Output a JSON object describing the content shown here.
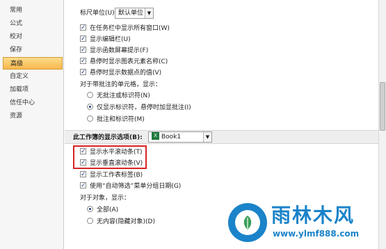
{
  "sidebar": {
    "items": [
      {
        "label": "常用"
      },
      {
        "label": "公式"
      },
      {
        "label": "校对"
      },
      {
        "label": "保存"
      },
      {
        "label": "高级"
      },
      {
        "label": "自定义"
      },
      {
        "label": "加载项"
      },
      {
        "label": "信任中心"
      },
      {
        "label": "资源"
      }
    ],
    "active_index": 4
  },
  "ruler_units": {
    "label": "标尺单位(U)",
    "value": "默认单位"
  },
  "display_options": [
    {
      "label": "在任务栏中显示所有窗口(W)",
      "checked": true
    },
    {
      "label": "显示编辑栏(U)",
      "checked": true
    },
    {
      "label": "显示函数屏幕提示(F)",
      "checked": true
    },
    {
      "label": "悬停时显示图表元素名称(C)",
      "checked": true
    },
    {
      "label": "悬停时显示数据点的值(V)",
      "checked": true
    }
  ],
  "comments": {
    "heading": "对于带批注的单元格，显示：",
    "options": [
      {
        "label": "无批注或标识符(N)",
        "selected": false
      },
      {
        "label": "仅显示标识符，悬停时加显批注(I)",
        "selected": true
      },
      {
        "label": "批注和标识符(M)",
        "selected": false
      }
    ]
  },
  "workbook_section": {
    "title": "此工作簿的显示选项(B):",
    "workbook": "Book1",
    "badge": "X"
  },
  "workbook_options": [
    {
      "label": "显示水平滚动条(T)",
      "checked": true
    },
    {
      "label": "显示垂直滚动条(V)",
      "checked": true
    },
    {
      "label": "显示工作表标签(B)",
      "checked": true
    },
    {
      "label": "使用“自动筛选”菜单分组日期(G)",
      "checked": true
    }
  ],
  "objects": {
    "heading": "对于对象，显示：",
    "options": [
      {
        "label": "全部(A)",
        "selected": true
      },
      {
        "label": "无内容(隐藏对象)(D)",
        "selected": false
      }
    ]
  },
  "watermark": {
    "title": "雨林木风",
    "url": "www.ylmf888.com"
  },
  "colors": {
    "accent": "#1a83c9",
    "highlight": "#d62424",
    "active_nav": "#f8b84e"
  }
}
